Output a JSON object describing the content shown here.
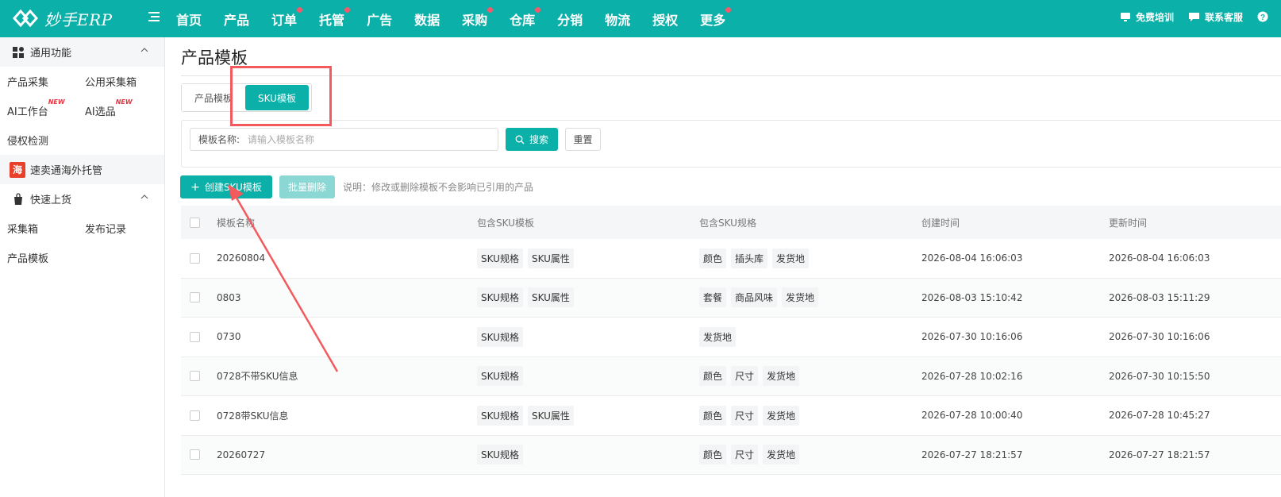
{
  "app": {
    "name": "妙手ERP"
  },
  "topnav": {
    "items": [
      {
        "label": "首页",
        "dot": false
      },
      {
        "label": "产品",
        "dot": false
      },
      {
        "label": "订单",
        "dot": true
      },
      {
        "label": "托管",
        "dot": true
      },
      {
        "label": "广告",
        "dot": false
      },
      {
        "label": "数据",
        "dot": false
      },
      {
        "label": "采购",
        "dot": true
      },
      {
        "label": "仓库",
        "dot": true
      },
      {
        "label": "分销",
        "dot": false
      },
      {
        "label": "物流",
        "dot": false
      },
      {
        "label": "授权",
        "dot": false
      },
      {
        "label": "更多",
        "dot": true
      }
    ],
    "training": "免费培训",
    "support": "联系客服",
    "help_icon": "question-icon",
    "accent": "#0bb0a8",
    "dot_color": "#f55a6a"
  },
  "sidebar": {
    "group_general": "通用功能",
    "row1": [
      "产品采集",
      "公用采集箱"
    ],
    "row2": [
      "AI工作台",
      "AI选品"
    ],
    "new_badge": "NEW",
    "row3": [
      "侵权检测"
    ],
    "special": {
      "icon_text": "海",
      "label": "速卖通海外托管"
    },
    "group_publish": "快速上货",
    "row4": [
      "采集箱",
      "发布记录"
    ],
    "row5": [
      "产品模板"
    ]
  },
  "main": {
    "title": "产品模板",
    "tabs": [
      "产品模板",
      "SKU模板"
    ],
    "active_tab": "SKU模板",
    "filter": {
      "label": "模板名称:",
      "placeholder": "请输入模板名称",
      "value": ""
    },
    "search_label": "搜索",
    "reset_label": "重置",
    "create_label": "创建SKU模板",
    "batch_delete_label": "批量删除",
    "note": "说明：修改或删除模板不会影响已引用的产品"
  },
  "table": {
    "columns": [
      "模板名称",
      "包含SKU模板",
      "包含SKU规格",
      "创建时间",
      "更新时间"
    ],
    "rows": [
      {
        "name": "20260804",
        "templates": [
          "SKU规格",
          "SKU属性"
        ],
        "specs": [
          "颜色",
          "插头库",
          "发货地"
        ],
        "created": "2026-08-04 16:06:03",
        "updated": "2026-08-04 16:06:03"
      },
      {
        "name": "0803",
        "templates": [
          "SKU规格",
          "SKU属性"
        ],
        "specs": [
          "套餐",
          "商品风味",
          "发货地"
        ],
        "created": "2026-08-03 15:10:42",
        "updated": "2026-08-03 15:11:29"
      },
      {
        "name": "0730",
        "templates": [
          "SKU规格"
        ],
        "specs": [
          "发货地"
        ],
        "created": "2026-07-30 10:16:06",
        "updated": "2026-07-30 10:16:06"
      },
      {
        "name": "0728不带SKU信息",
        "templates": [
          "SKU规格"
        ],
        "specs": [
          "颜色",
          "尺寸",
          "发货地"
        ],
        "created": "2026-07-28 10:02:16",
        "updated": "2026-07-30 10:15:50"
      },
      {
        "name": "0728带SKU信息",
        "templates": [
          "SKU规格",
          "SKU属性"
        ],
        "specs": [
          "颜色",
          "尺寸",
          "发货地"
        ],
        "created": "2026-07-28 10:00:40",
        "updated": "2026-07-28 10:45:27"
      },
      {
        "name": "20260727",
        "templates": [
          "SKU规格"
        ],
        "specs": [
          "颜色",
          "尺寸",
          "发货地"
        ],
        "created": "2026-07-27 18:21:57",
        "updated": "2026-07-27 18:21:57"
      }
    ]
  },
  "annotation_color": "#f25a5d"
}
